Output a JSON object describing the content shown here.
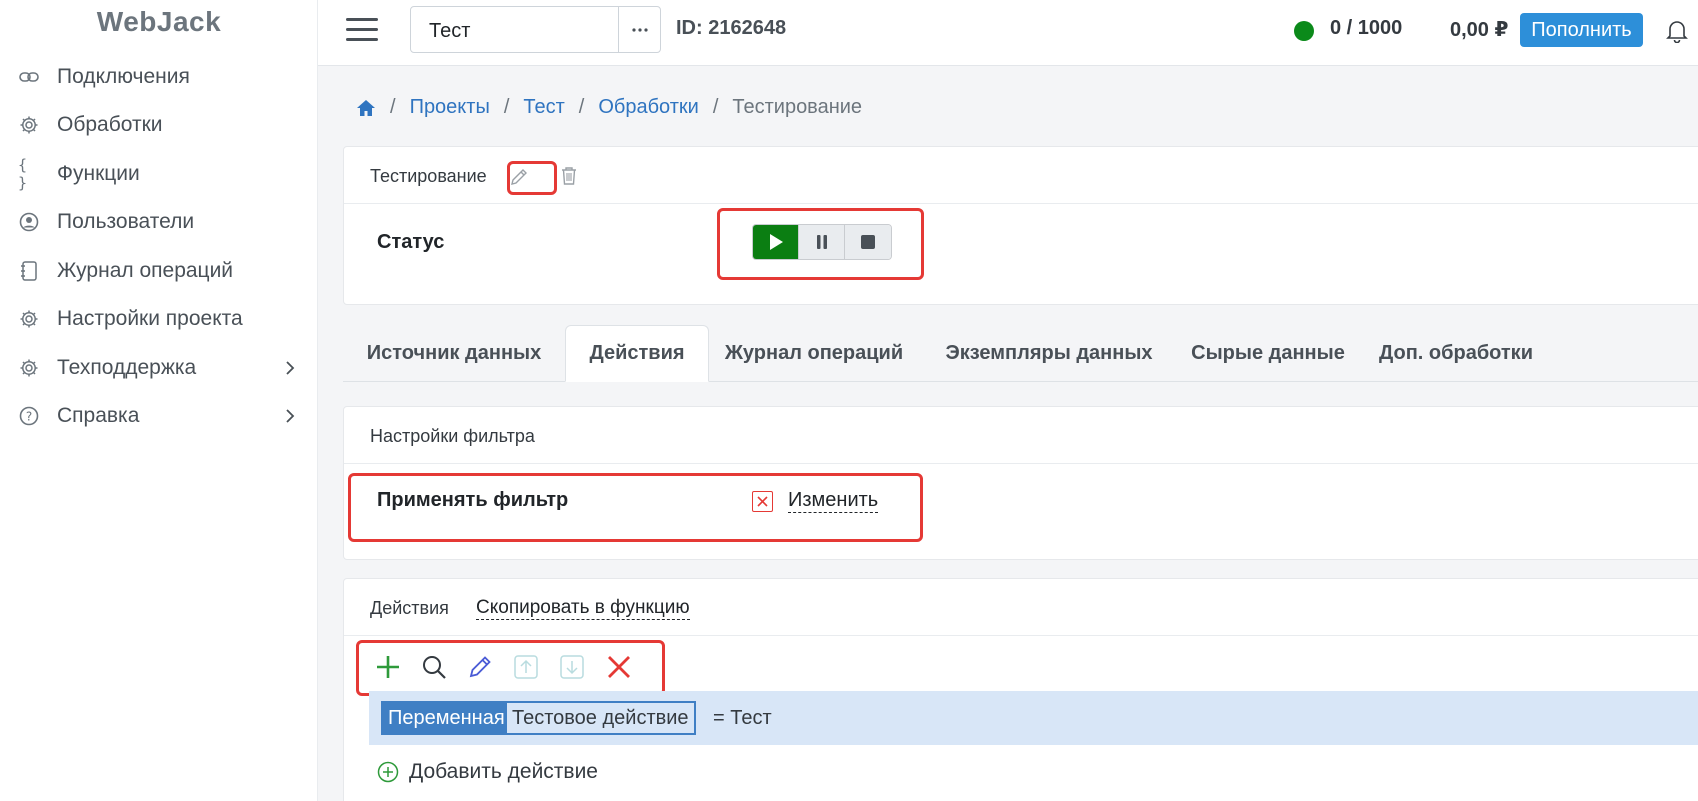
{
  "app": {
    "logo": "WebJack"
  },
  "sidebar": {
    "items": [
      {
        "label": "Подключения",
        "icon": "link-icon"
      },
      {
        "label": "Обработки",
        "icon": "gear-icon"
      },
      {
        "label": "Функции",
        "icon": "braces-icon"
      },
      {
        "label": "Пользователи",
        "icon": "user-circle-icon"
      },
      {
        "label": "Журнал операций",
        "icon": "journal-icon"
      },
      {
        "label": "Настройки проекта",
        "icon": "gear-icon"
      },
      {
        "label": "Техподдержка",
        "icon": "gear-icon",
        "has_submenu": true
      },
      {
        "label": "Справка",
        "icon": "question-circle-icon",
        "has_submenu": true
      }
    ]
  },
  "topbar": {
    "project_value": "Тест",
    "more_label": "···",
    "project_id": "ID: 2162648",
    "status_color": "#0b8a1a",
    "counter": "0 / 1000",
    "balance": "0,00 ₽",
    "topup_label": "Пополнить"
  },
  "breadcrumb": {
    "items": [
      "Проекты",
      "Тест",
      "Обработки"
    ],
    "current": "Тестирование",
    "separator": "/"
  },
  "processing": {
    "title": "Тестирование",
    "status_label": "Статус",
    "controls": [
      "play",
      "pause",
      "stop"
    ]
  },
  "tabs": [
    {
      "label": "Источник данных",
      "active": false
    },
    {
      "label": "Действия",
      "active": true
    },
    {
      "label": "Журнал операций",
      "active": false
    },
    {
      "label": "Экземпляры данных",
      "active": false
    },
    {
      "label": "Сырые данные",
      "active": false
    },
    {
      "label": "Доп. обработки",
      "active": false
    }
  ],
  "filter": {
    "header": "Настройки фильтра",
    "label": "Применять фильтр",
    "change_link": "Изменить"
  },
  "actions": {
    "header": "Действия",
    "copy_link": "Скопировать в функцию",
    "toolbar": [
      "add",
      "search",
      "edit",
      "move-up",
      "move-down",
      "delete"
    ],
    "row": {
      "type_tag": "Переменная",
      "name_tag": "Тестовое действие",
      "assignment": "= Тест"
    },
    "add_label": "Добавить действие"
  },
  "colors": {
    "accent": "#2d8fd9",
    "link": "#2f74c0",
    "play": "#0b7e12",
    "highlight": "#e53935"
  }
}
